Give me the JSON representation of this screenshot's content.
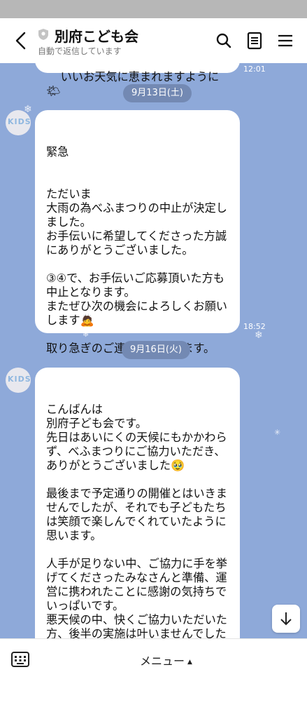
{
  "header": {
    "title": "別府こども会",
    "subtitle": "自動で返信しています"
  },
  "chat": {
    "partial_top_text": "いいお天気に恵まれますように",
    "partial_top_time": "12:01",
    "messages": [
      {
        "date": "9月13日(土)",
        "avatar_text": "KIDS",
        "text": "緊急\n\n\nただいま\n大雨の為べふまつりの中止が決定しました。\nお手伝いに希望してくださった方誠にありがとうございました。\n\n③④で、お手伝いご応募頂いた方も中止となります。\nまたぜひ次の機会によろしくお願いします🙇\n\n取り急ぎのご連絡で失礼します。",
        "time": "18:52"
      },
      {
        "date": "9月16日(火)",
        "avatar_text": "KIDS",
        "text": "こんばんは\n別府子ども会です。\n先日はあいにくの天候にもかかわらず、べふまつりにご協力いただき、ありがとうございました🥹\n\n最後まで予定通りの開催とはいきませんでしたが、それでも子どもたちは笑顔で楽しんでくれていたように思います。\n\n人手が足りない中、ご協力に手を挙げてくださったみなさんと準備、運営に携われたことに感謝の気持ちでいっぱいです。\n悪天候の中、快くご協力いただいた方、後半の実施は叶いませんでしたが、予定を空けて準備していただいていた方、全ての方に心よ",
        "time": ""
      }
    ]
  },
  "footer": {
    "menu_label": "メニュー",
    "menu_caret": "▲"
  },
  "icons": {
    "back": "chevron-left-icon",
    "shield": "shield-icon",
    "search": "search-icon",
    "notes": "notes-icon",
    "menu": "hamburger-menu-icon",
    "keyboard": "keyboard-icon",
    "scroll_down": "arrow-down-icon"
  },
  "colors": {
    "chat_bg": "#8ea9d9",
    "date_pill": "#7389b3",
    "bubble": "#ffffff"
  }
}
